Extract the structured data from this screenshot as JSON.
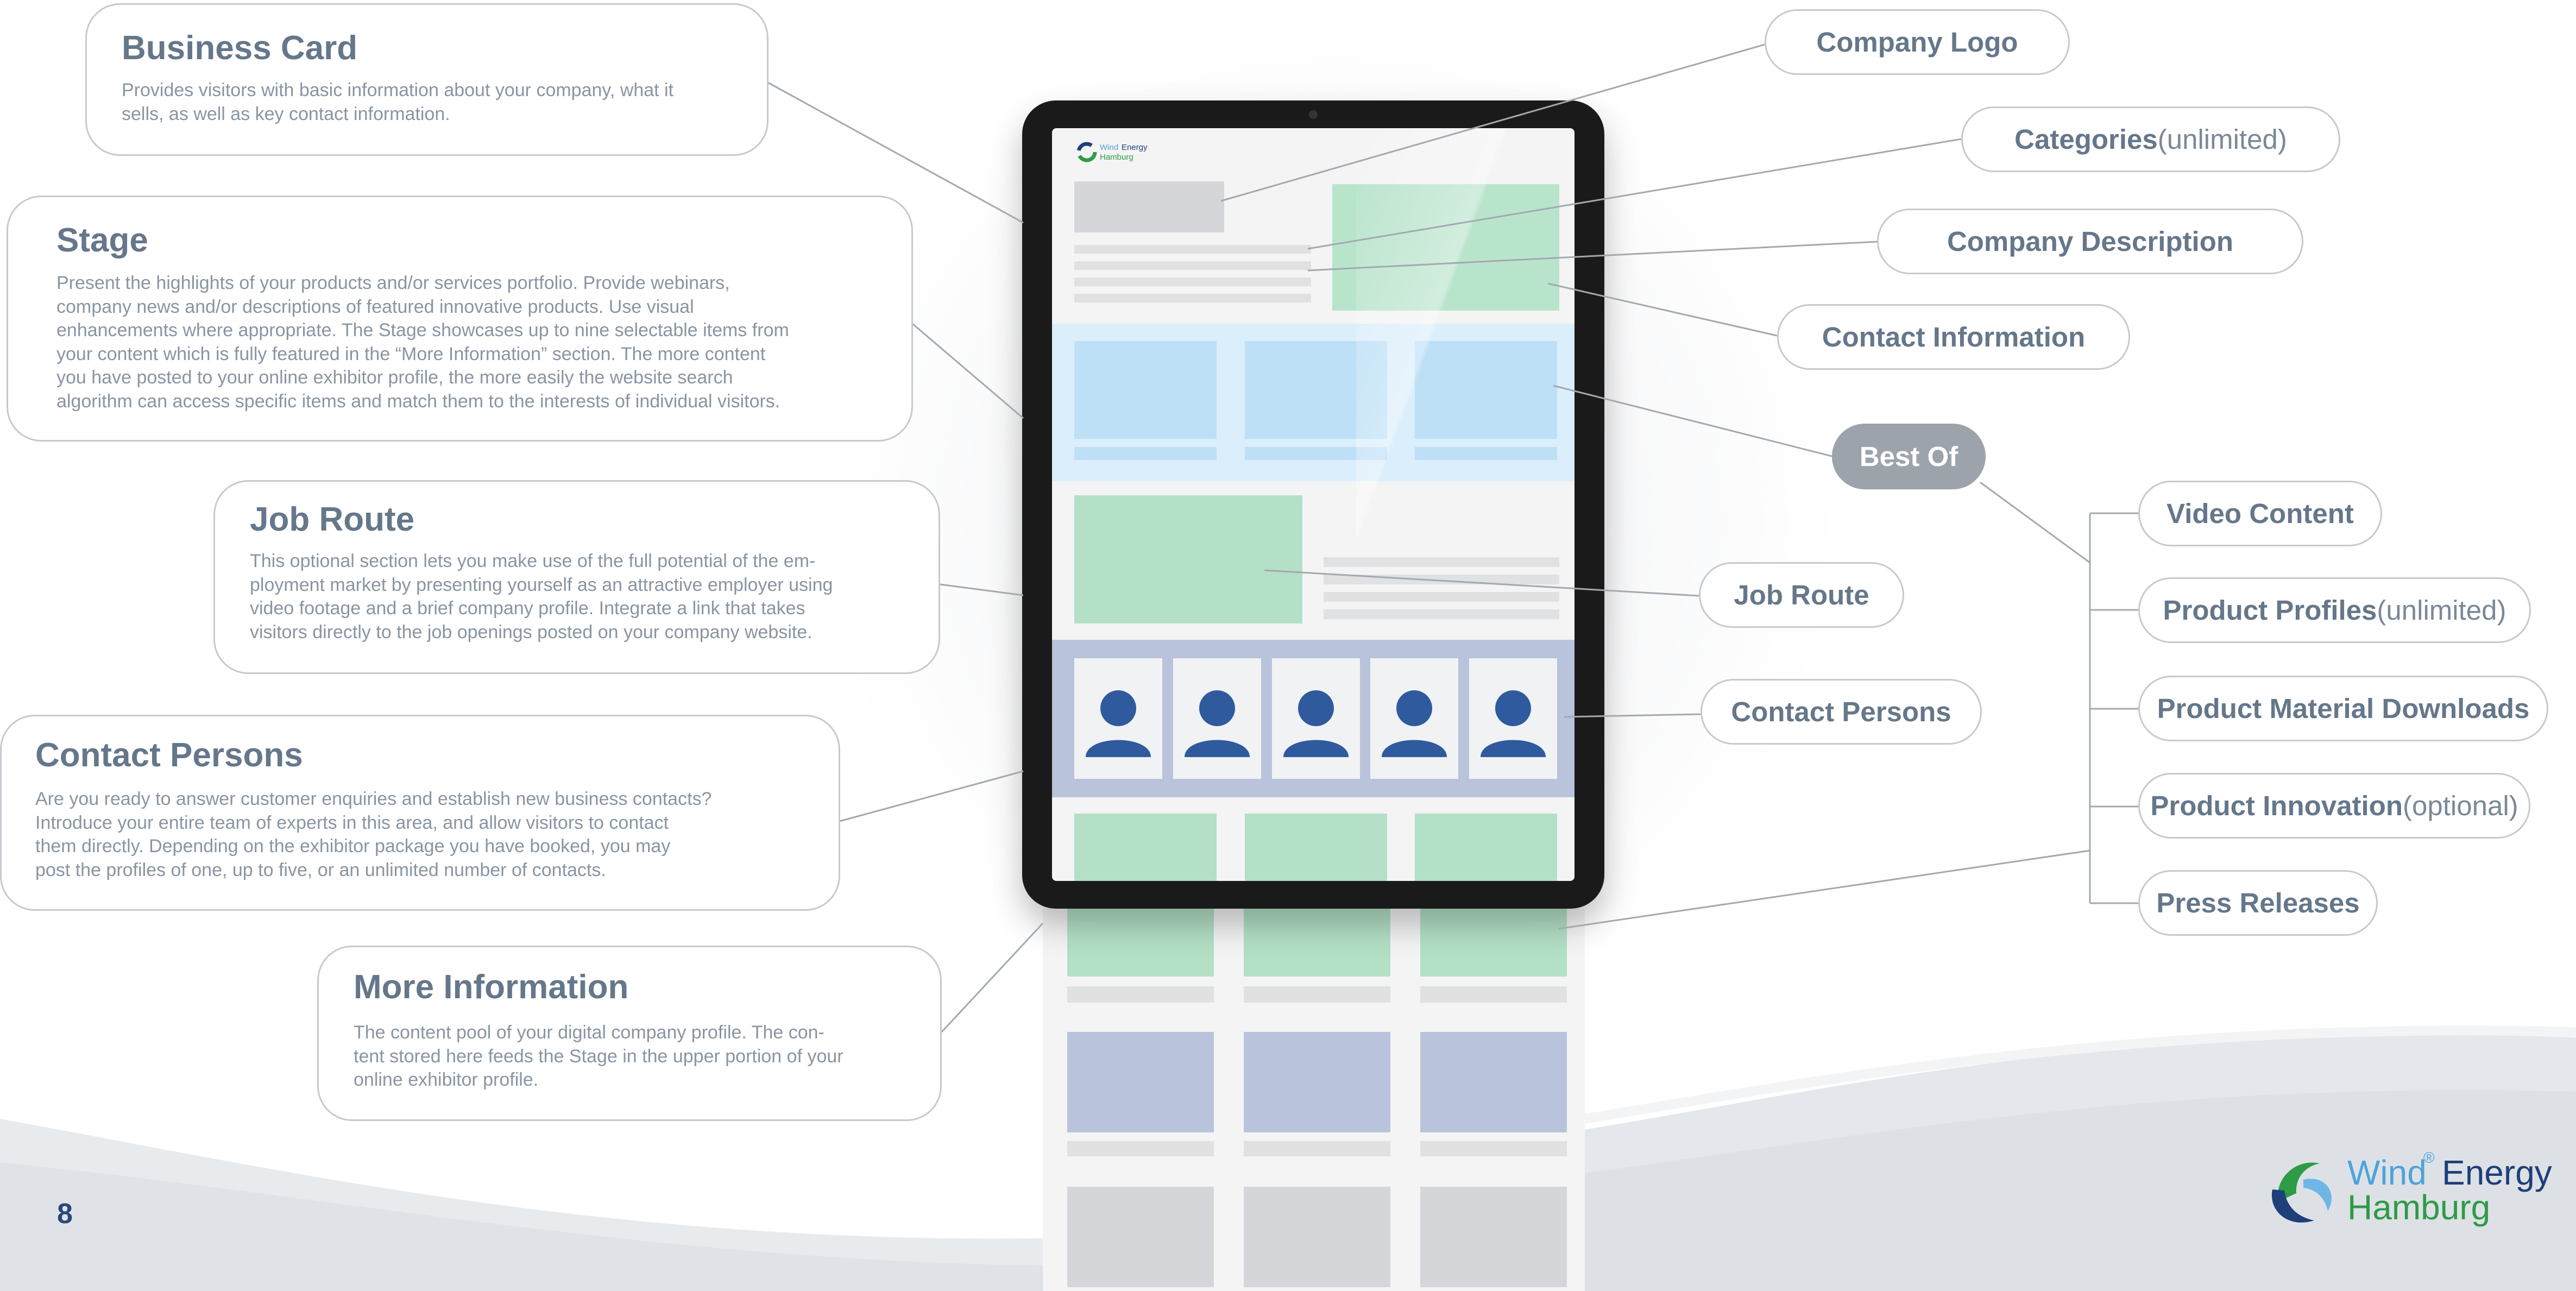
{
  "page": {
    "number": "8"
  },
  "brand": {
    "word1": "Wind",
    "reg": "®",
    "word2": "Energy",
    "word3": "Hamburg",
    "colors": {
      "blue": "#4da3dc",
      "navy": "#1d3f7a",
      "green": "#2e9b45"
    }
  },
  "left_boxes": [
    {
      "title": "Business Card",
      "lines": [
        "Provides visitors with basic information about your company, what it",
        "sells, as well as key contact information."
      ]
    },
    {
      "title": "Stage",
      "lines": [
        "Present the highlights of your products and/or services portfolio. Provide webinars,",
        "company news and/or descriptions of featured innovative products. Use visual",
        "enhancements where appropriate. The Stage showcases up to nine selectable items from",
        "your content which is fully featured in the “More Information” section. The more content",
        "you have posted to your online exhibitor profile, the more easily the website search",
        "algorithm can access specific items and match them to the interests of individual visitors."
      ]
    },
    {
      "title": "Job Route",
      "lines": [
        "This optional section lets you make use of the full potential of the em-",
        "ployment market by presenting yourself as an attractive employer using",
        "video footage and a brief company profile. Integrate a link that takes",
        "visitors directly to the job openings posted on your company website."
      ]
    },
    {
      "title": "Contact Persons",
      "lines": [
        "Are you ready to answer customer enquiries and establish new business contacts?",
        "Introduce your entire team of experts in this area, and allow visitors to contact",
        "them directly. Depending on the exhibitor package you have booked, you may",
        "post the profiles of one, up to five, or an unlimited number of contacts."
      ]
    },
    {
      "title": "More Information",
      "lines": [
        "The content pool of your digital company profile. The con-",
        "tent stored here feeds the Stage in the upper portion of your",
        "online exhibitor profile."
      ]
    }
  ],
  "right_labels": [
    {
      "strong": "Company Logo",
      "light": ""
    },
    {
      "strong": "Categories",
      "light": " (unlimited)"
    },
    {
      "strong": "Company Description",
      "light": ""
    },
    {
      "strong": "Contact Information",
      "light": ""
    },
    {
      "strong": "Best Of",
      "light": ""
    },
    {
      "strong": "Job Route",
      "light": ""
    },
    {
      "strong": "Contact Persons",
      "light": ""
    }
  ],
  "best_of_items": [
    {
      "strong": "Video Content",
      "light": ""
    },
    {
      "strong": "Product Profiles",
      "light": " (unlimited)"
    },
    {
      "strong": "Product Material Downloads",
      "light": ""
    },
    {
      "strong": "Product Innovation",
      "light": " (optional)"
    },
    {
      "strong": "Press Releases",
      "light": ""
    }
  ]
}
